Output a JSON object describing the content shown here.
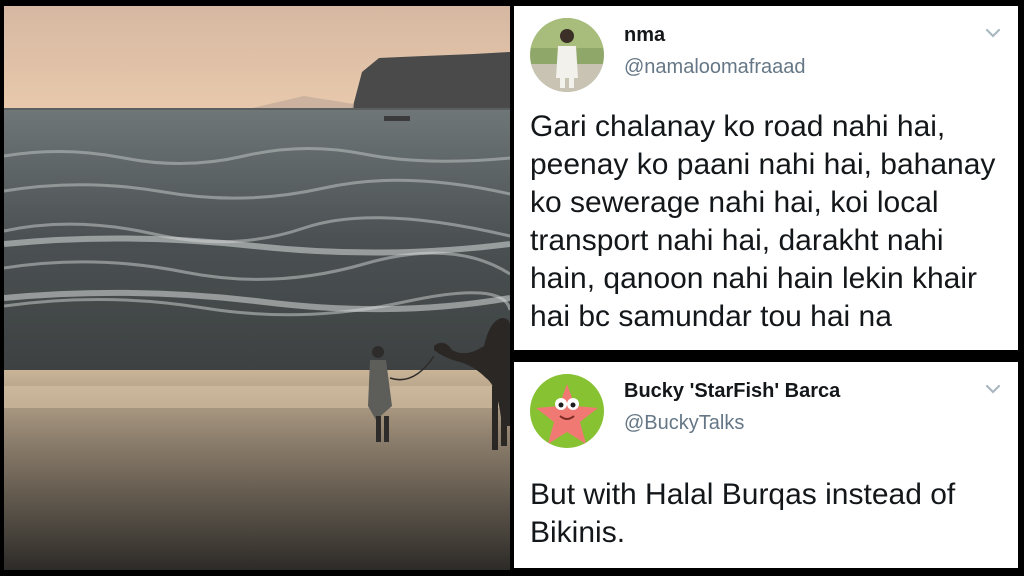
{
  "photo": {
    "description": "beach-at-sunset-with-man-leading-camel"
  },
  "tweets": [
    {
      "display_name": "nma",
      "handle": "@namaloomafraaad",
      "text": "Gari chalanay ko road nahi hai,\npeenay ko paani nahi hai, bahanay\nko sewerage nahi hai, koi local\ntransport nahi hai, darakht nahi\nhain, qanoon nahi hain lekin khair\nhai bc samundar tou hai na"
    },
    {
      "display_name": "Bucky 'StarFish' Barca",
      "handle": "@BuckyTalks",
      "text": "But with Halal Burqas instead of\nBikinis."
    }
  ],
  "colors": {
    "handle": "#657786",
    "text": "#14171a",
    "avatar2_bg": "#86c232",
    "starfish": "#f07a73"
  }
}
